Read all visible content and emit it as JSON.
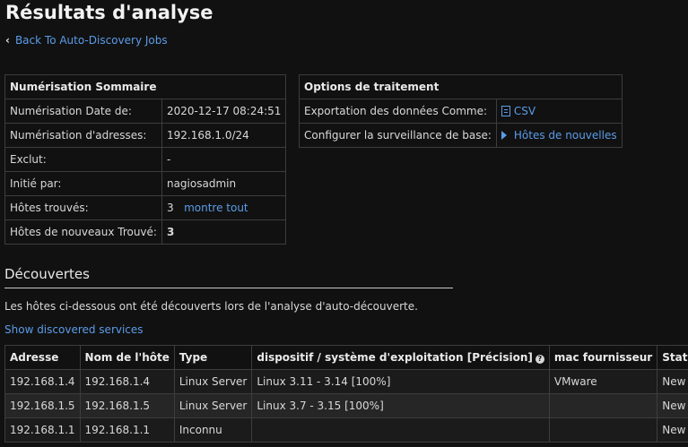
{
  "page": {
    "title": "Résultats d'analyse",
    "back_link": "Back To Auto-Discovery Jobs"
  },
  "summary": {
    "header": "Numérisation Sommaire",
    "rows": [
      {
        "label": "Numérisation Date de:",
        "value": "2020-12-17 08:24:51"
      },
      {
        "label": "Numérisation d'adresses:",
        "value": "192.168.1.0/24"
      },
      {
        "label": "Exclut:",
        "value": "-"
      },
      {
        "label": "Initié par:",
        "value": "nagiosadmin"
      },
      {
        "label": "Hôtes trouvés:",
        "value": "3",
        "link": "montre tout"
      },
      {
        "label": "Hôtes de nouveaux Trouvé:",
        "value": "3"
      }
    ]
  },
  "options": {
    "header": "Options de traitement",
    "export_label": "Exportation des données Comme:",
    "export_link": "CSV",
    "monitor_label": "Configurer la surveillance de base:",
    "monitor_link": "Hôtes de nouvelles"
  },
  "discoveries": {
    "title": "Découvertes",
    "description": "Les hôtes ci-dessous ont été découverts lors de l'analyse d'auto-découverte.",
    "show_link": "Show discovered services",
    "columns": [
      "Adresse",
      "Nom de l'hôte",
      "Type",
      "dispositif / système d'exploitation [Précision]",
      "mac fournisseur",
      "Statut"
    ],
    "rows": [
      [
        "192.168.1.4",
        "192.168.1.4",
        "Linux Server",
        "Linux 3.11 - 3.14 [100%]",
        "VMware",
        "New"
      ],
      [
        "192.168.1.5",
        "192.168.1.5",
        "Linux Server",
        "Linux 3.7 - 3.15 [100%]",
        "",
        "New"
      ],
      [
        "192.168.1.1",
        "192.168.1.1",
        "Inconnu",
        "",
        "",
        "New"
      ]
    ]
  },
  "icons": {
    "back": "chevron-left-icon",
    "csv": "document-icon",
    "monitor": "play-triangle-icon",
    "help": "question-circle-icon"
  }
}
